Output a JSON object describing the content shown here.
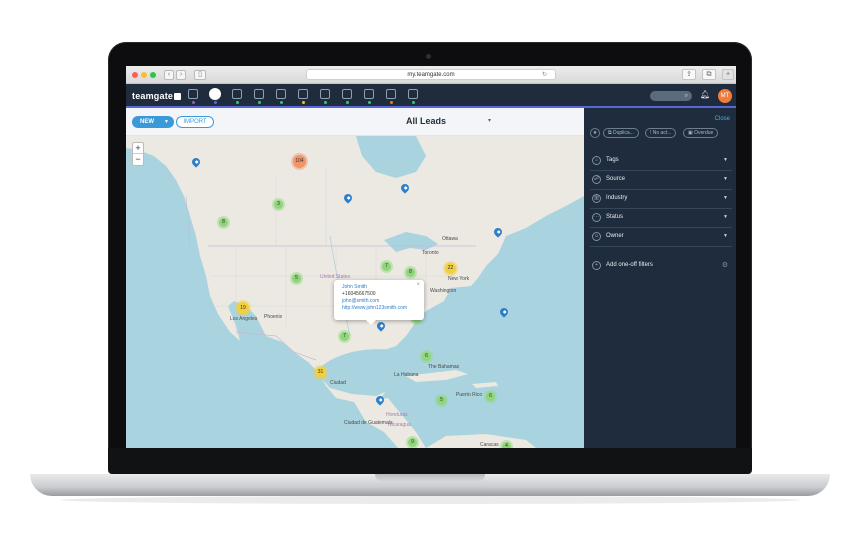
{
  "browser": {
    "url": "my.teamgate.com",
    "reload_icon": "reload-icon",
    "nav_back": "‹",
    "nav_forward": "›"
  },
  "app": {
    "logo": "teamgate",
    "nav_icons": [
      "dashboard-icon",
      "leads-icon",
      "companies-icon",
      "deals-icon",
      "calendar-icon",
      "campaigns-icon",
      "tasks-icon",
      "documents-icon",
      "reports-icon",
      "email-icon",
      "files-icon"
    ],
    "nav_dot_colors": [
      "#9b59b6",
      "#5a67d8",
      "#2ecc71",
      "#2ecc71",
      "#2ecc71",
      "#f1c40f",
      "#2ecc71",
      "#2ecc71",
      "#2ecc71",
      "#e67e22",
      "#2ecc71",
      "#e67e22"
    ],
    "user_initials": "MT",
    "accent": "#3a9ad9",
    "nav_bg": "#1e2c3d"
  },
  "toolbar": {
    "new_label": "NEW",
    "import_label": "IMPORT",
    "view_title": "All Leads"
  },
  "map": {
    "zoom_in": "+",
    "zoom_out": "−",
    "labels": {
      "ottawa": "Ottawa",
      "toronto": "Toronto",
      "new_york": "New York",
      "washington": "Washington",
      "united_states": "United States",
      "los_angeles": "Los Angeles",
      "phoenix": "Phoenix",
      "ciudad": "Ciudad",
      "guatemala": "Ciudad de Guatemala",
      "honduras": "Honduras",
      "nicaragua": "Nicaragua",
      "la_habana": "La Habana",
      "the_bahamas": "The Bahamas",
      "caracas": "Caracas",
      "puerto_rico": "Puerto Rico"
    },
    "clusters": [
      {
        "count": "104",
        "color": "orange"
      },
      {
        "count": "22",
        "color": "yellow"
      },
      {
        "count": "19",
        "color": "yellow"
      },
      {
        "count": "31",
        "color": "yellow"
      },
      {
        "count": "8",
        "color": "green"
      },
      {
        "count": "3",
        "color": "green"
      },
      {
        "count": "5",
        "color": "green"
      },
      {
        "count": "7",
        "color": "green"
      },
      {
        "count": "8",
        "color": "green"
      },
      {
        "count": "7",
        "color": "green"
      },
      {
        "count": "6",
        "color": "green"
      },
      {
        "count": "5",
        "color": "green"
      },
      {
        "count": "6",
        "color": "green"
      },
      {
        "count": "9",
        "color": "green"
      },
      {
        "count": "4",
        "color": "green"
      }
    ],
    "popup": {
      "name": "John Smith",
      "phone": "+16045667500",
      "email": "john@smith.com",
      "website": "http://www.john123smith.com",
      "close": "×"
    }
  },
  "filters": {
    "close_label": "Close",
    "chips": [
      "Duplica...",
      "No act...",
      "Overdue"
    ],
    "rows": [
      {
        "label": "Tags",
        "icon": "tag-icon"
      },
      {
        "label": "Source",
        "icon": "source-icon"
      },
      {
        "label": "Industry",
        "icon": "industry-icon"
      },
      {
        "label": "Status",
        "icon": "status-icon"
      },
      {
        "label": "Owner",
        "icon": "owner-icon"
      }
    ],
    "add_label": "Add one-off filters"
  }
}
